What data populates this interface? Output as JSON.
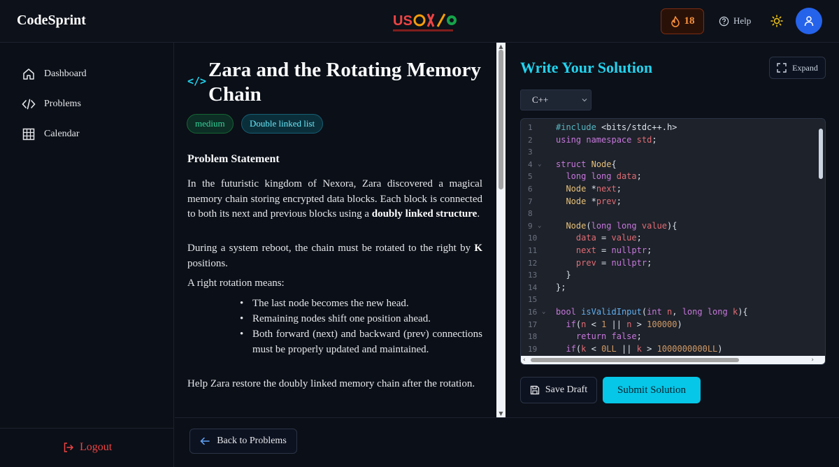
{
  "header": {
    "brand": "CodeSprint",
    "streak": "18",
    "help_label": "Help"
  },
  "sidebar": {
    "items": [
      {
        "label": "Dashboard",
        "icon": "home-icon"
      },
      {
        "label": "Problems",
        "icon": "code-icon"
      },
      {
        "label": "Calendar",
        "icon": "grid-icon"
      }
    ],
    "logout_label": "Logout"
  },
  "problem": {
    "title": "Zara and the Rotating Memory Chain",
    "difficulty": "medium",
    "topic": "Double linked list",
    "statement_heading": "Problem Statement",
    "p1_text": "In the futuristic kingdom of Nexora, Zara discovered a magical memory chain storing encrypted data blocks. Each block is connected to both its next and previous blocks using a ",
    "p1_bold": "doubly linked structure",
    "p1_end": ".",
    "p2_text": "During a system reboot, the chain must be rotated to the right by ",
    "p2_bold": "K",
    "p2_end": " positions.",
    "p3": "A right rotation means:",
    "bullets": [
      "The last node becomes the new head.",
      "Remaining nodes shift one position ahead.",
      "Both forward (next) and backward (prev) connections must be properly updated and maintained."
    ],
    "p4": "Help Zara restore the doubly linked memory chain after the rotation.",
    "back_label": "Back to Problems"
  },
  "editor": {
    "title": "Write Your Solution",
    "expand_label": "Expand",
    "language": "C++",
    "save_label": "Save Draft",
    "submit_label": "Submit Solution",
    "line_numbers": [
      "1",
      "2",
      "3",
      "4",
      "5",
      "6",
      "7",
      "8",
      "9",
      "10",
      "11",
      "12",
      "13",
      "14",
      "15",
      "16",
      "17",
      "18",
      "19"
    ],
    "code_lines": [
      "#include <bits/stdc++.h>",
      "using namespace std;",
      "",
      "struct Node{",
      "  long long data;",
      "  Node *next;",
      "  Node *prev;",
      "",
      "  Node(long long value){",
      "    data = value;",
      "    next = nullptr;",
      "    prev = nullptr;",
      "  }",
      "};",
      "",
      "bool isValidInput(int n, long long k){",
      "  if(n < 1 || n > 100000)",
      "    return false;",
      "  if(k < 0LL || k > 1000000000LL)"
    ]
  }
}
